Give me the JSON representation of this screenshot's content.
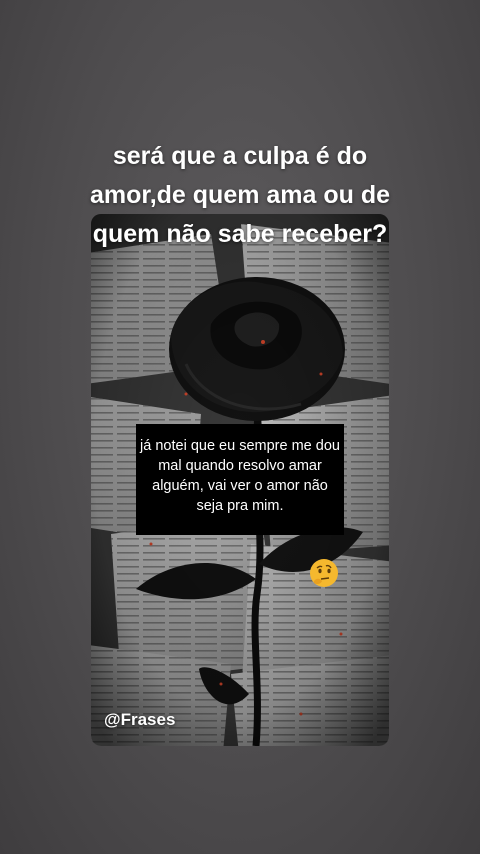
{
  "story": {
    "headline": "será que a culpa é do amor,de quem ama ou de quem não sabe receber?",
    "quote": "já notei que eu sempre me dou mal quando resolvo amar alguém, vai ver o amor não seja pra mim.",
    "handle": "@Frases",
    "sticker_icon": "thinking-face-icon",
    "photo_subject": "black-rose-icon"
  },
  "colors": {
    "background": "#4e4c4e",
    "quote_box": "#000000",
    "text": "#ffffff",
    "emoji": "#f5b82e"
  }
}
